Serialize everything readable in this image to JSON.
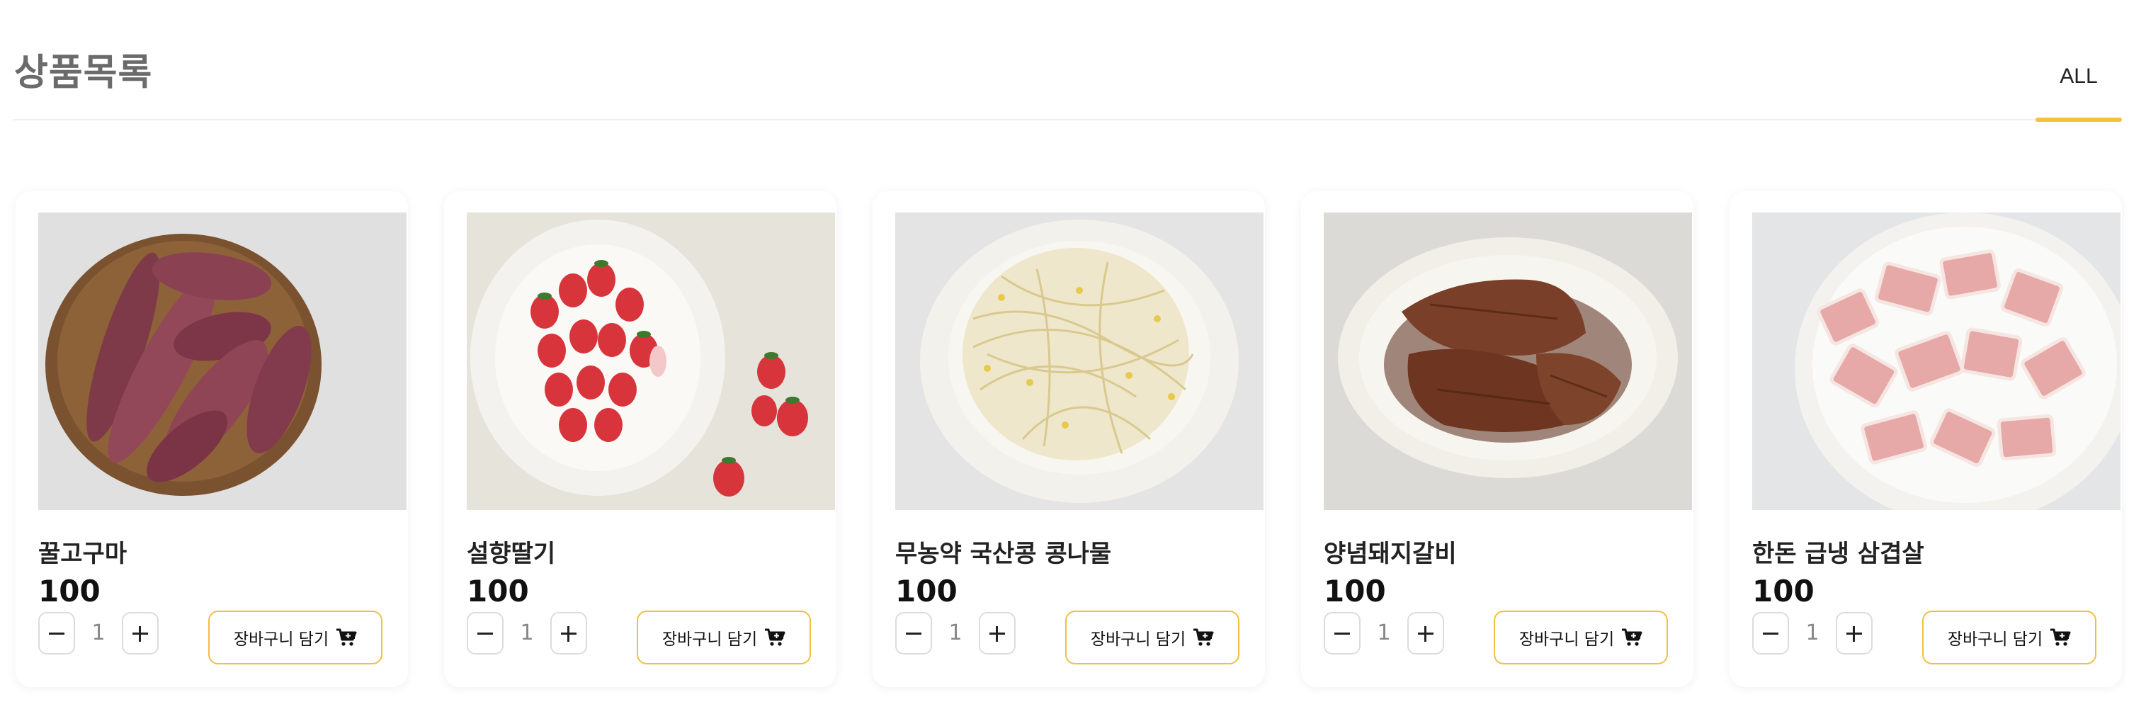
{
  "header": {
    "title": "상품목록",
    "tab_all": "ALL"
  },
  "colors": {
    "accent": "#f5c13d",
    "button_border": "#f2bf42",
    "title_gray": "#6b6b6b"
  },
  "products": [
    {
      "name": "꿀고구마",
      "price": "100",
      "qty": "1",
      "cart_label": "장바구니 담기",
      "image": "sweet-potato-image"
    },
    {
      "name": "설향딸기",
      "price": "100",
      "qty": "1",
      "cart_label": "장바구니 담기",
      "image": "strawberry-image"
    },
    {
      "name": "무농약 국산콩 콩나물",
      "price": "100",
      "qty": "1",
      "cart_label": "장바구니 담기",
      "image": "bean-sprouts-image"
    },
    {
      "name": "양념돼지갈비",
      "price": "100",
      "qty": "1",
      "cart_label": "장바구니 담기",
      "image": "pork-ribs-image"
    },
    {
      "name": "한돈 급냉 삼겹살",
      "price": "100",
      "qty": "1",
      "cart_label": "장바구니 담기",
      "image": "pork-belly-image"
    }
  ]
}
